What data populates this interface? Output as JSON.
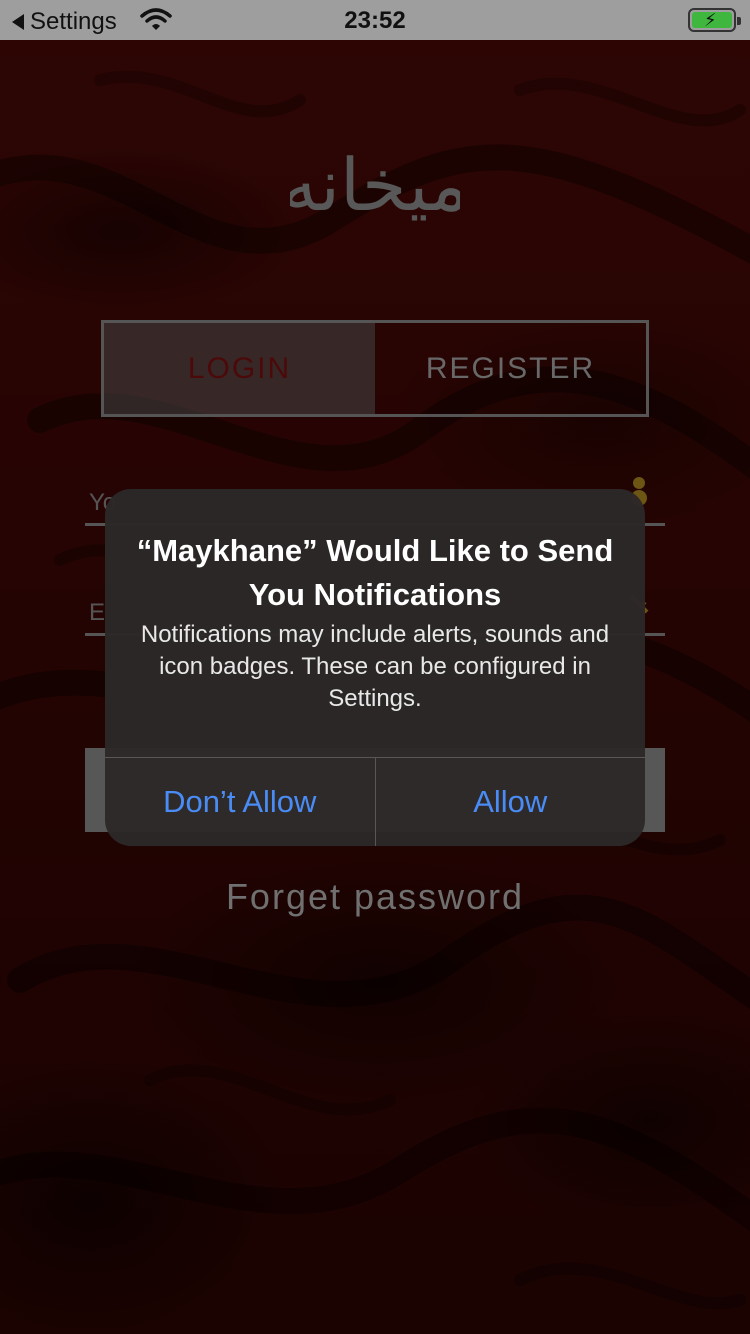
{
  "status_bar": {
    "back_label": "Settings",
    "time": "23:52",
    "battery_color": "#3fb73f"
  },
  "app": {
    "logo_text": "میخانه",
    "tabs": [
      {
        "label": "LOGIN",
        "active": true
      },
      {
        "label": "REGISTER",
        "active": false
      }
    ],
    "username_placeholder": "Yo",
    "email_placeholder": "E",
    "forget_password": "Forget password",
    "accent_color": "#7a1010",
    "icon_color": "#b08a20"
  },
  "alert": {
    "title": "“Maykhane” Would Like to Send You Notifications",
    "message": "Notifications may include alerts, sounds and icon badges. These can be configured in Settings.",
    "buttons": [
      {
        "label": "Don’t Allow"
      },
      {
        "label": "Allow"
      }
    ],
    "button_color": "#4a8cf5"
  }
}
